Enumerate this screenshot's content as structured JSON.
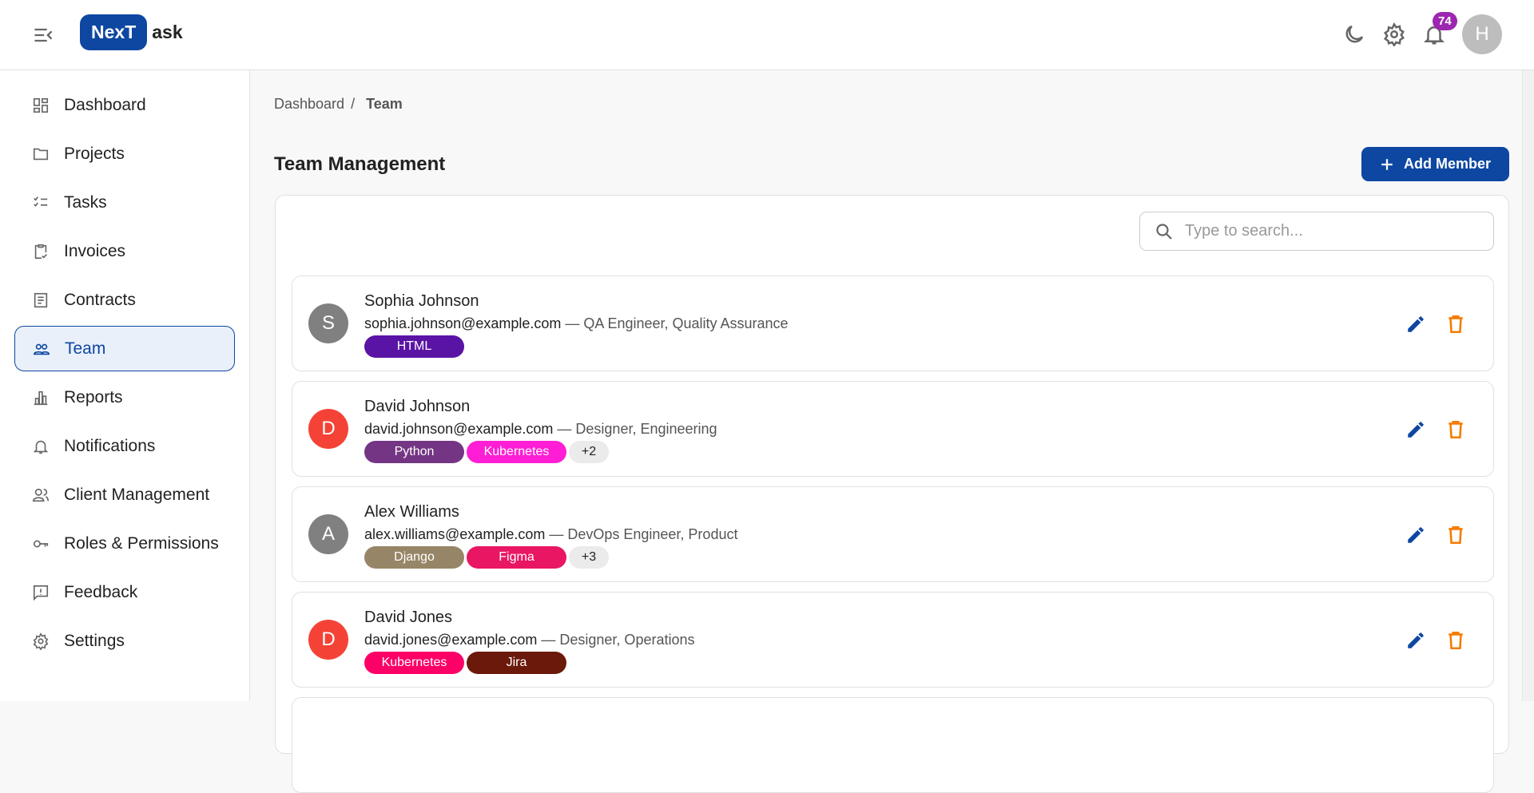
{
  "header": {
    "logo_box": "NexT",
    "logo_rest": "ask",
    "notification_count": "74",
    "user_initial": "H"
  },
  "sidebar": {
    "items": [
      {
        "label": "Dashboard",
        "icon": "dashboard-icon"
      },
      {
        "label": "Projects",
        "icon": "folder-icon"
      },
      {
        "label": "Tasks",
        "icon": "checklist-icon"
      },
      {
        "label": "Invoices",
        "icon": "clipboard-check-icon"
      },
      {
        "label": "Contracts",
        "icon": "document-icon"
      },
      {
        "label": "Team",
        "icon": "people-icon",
        "active": true
      },
      {
        "label": "Reports",
        "icon": "bar-chart-icon"
      },
      {
        "label": "Notifications",
        "icon": "bell-icon"
      },
      {
        "label": "Client Management",
        "icon": "users-icon"
      },
      {
        "label": "Roles & Permissions",
        "icon": "key-icon"
      },
      {
        "label": "Feedback",
        "icon": "feedback-icon"
      },
      {
        "label": "Settings",
        "icon": "gear-icon"
      }
    ]
  },
  "breadcrumb": {
    "parent": "Dashboard",
    "sep": "/",
    "current": "Team"
  },
  "page": {
    "title": "Team Management",
    "add_label": "Add Member",
    "search_placeholder": "Type to search..."
  },
  "members": [
    {
      "initial": "S",
      "color": "#808080",
      "name": "Sophia Johnson",
      "email": "sophia.johnson@example.com",
      "role": " — QA Engineer, Quality Assurance",
      "skills": [
        {
          "label": "HTML",
          "color": "#5a14a5"
        }
      ],
      "more": ""
    },
    {
      "initial": "D",
      "color": "#f44336",
      "name": "David Johnson",
      "email": "david.johnson@example.com",
      "role": " — Designer, Engineering",
      "skills": [
        {
          "label": "Python",
          "color": "#743684"
        },
        {
          "label": "Kubernetes",
          "color": "#ff1ed5"
        }
      ],
      "more": "+2"
    },
    {
      "initial": "A",
      "color": "#808080",
      "name": "Alex Williams",
      "email": "alex.williams@example.com",
      "role": " — DevOps Engineer, Product",
      "skills": [
        {
          "label": "Django",
          "color": "#978567"
        },
        {
          "label": "Figma",
          "color": "#e91763"
        }
      ],
      "more": "+3"
    },
    {
      "initial": "D",
      "color": "#f44336",
      "name": "David Jones",
      "email": "david.jones@example.com",
      "role": " — Designer, Operations",
      "skills": [
        {
          "label": "Kubernetes",
          "color": "#fc0068"
        },
        {
          "label": "Jira",
          "color": "#6b190b"
        }
      ],
      "more": ""
    }
  ],
  "colors": {
    "primary": "#0d47a1",
    "edit": "#0d47a1",
    "delete": "#f57c00"
  }
}
